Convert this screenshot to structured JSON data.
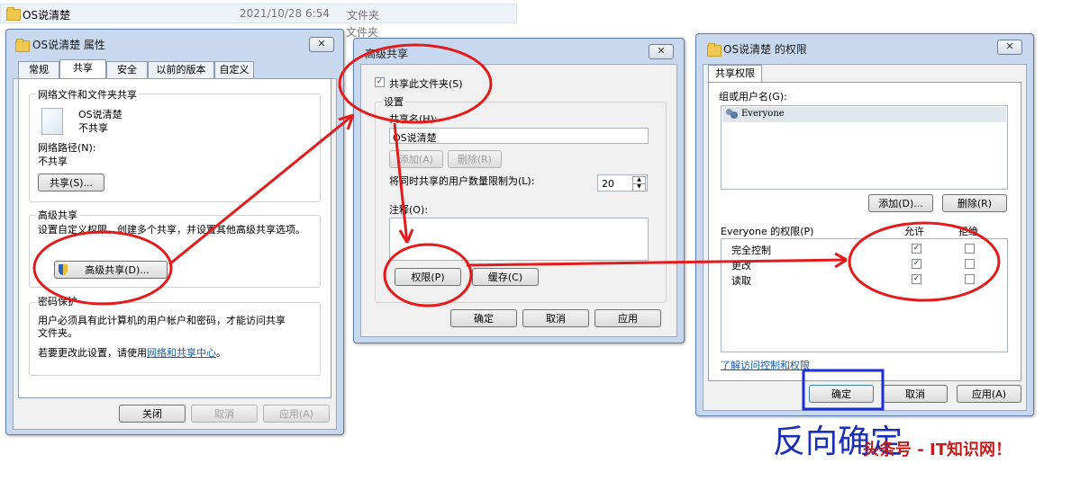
{
  "explorer": {
    "name": "OS说清楚",
    "date": "2021/10/28 6:54",
    "type": "文件夹",
    "type2": "文件夹"
  },
  "props": {
    "title": "OS说清楚 属性",
    "tabs": [
      "常规",
      "共享",
      "安全",
      "以前的版本",
      "自定义"
    ],
    "net_share_heading": "网络文件和文件夹共享",
    "folder_name": "OS说清楚",
    "folder_status": "不共享",
    "network_path_label": "网络路径(N):",
    "network_path_value": "不共享",
    "share_button": "共享(S)...",
    "adv_heading": "高级共享",
    "adv_desc": "设置自定义权限，创建多个共享，并设置其他高级共享选项。",
    "adv_button": "高级共享(D)...",
    "pw_heading": "密码保护",
    "pw_desc1": "用户必须具有此计算机的用户帐户和密码，才能访问共享",
    "pw_desc2": "文件夹。",
    "change_prefix": "若要更改此设置，请使用",
    "change_link": "网络和共享中心",
    "change_suffix": "。",
    "close": "关闭",
    "cancel": "取消",
    "apply": "应用(A)"
  },
  "adv": {
    "title": "高级共享",
    "share_check": "共享此文件夹(S)",
    "settings": "设置",
    "share_name_label": "共享名(H):",
    "share_name_value": "OS说清楚",
    "add": "添加(A)",
    "remove": "删除(R)",
    "limit_label": "将同时共享的用户数量限制为(L):",
    "limit_value": "20",
    "comment_label": "注释(O):",
    "perm_button": "权限(P)",
    "cache_button": "缓存(C)",
    "ok": "确定",
    "cancel": "取消",
    "apply": "应用"
  },
  "perm": {
    "title": "OS说清楚 的权限",
    "tab": "共享权限",
    "group_label": "组或用户名(G):",
    "user": "Everyone",
    "add": "添加(D)...",
    "remove": "删除(R)",
    "perm_for": "Everyone 的权限(P)",
    "allow": "允许",
    "deny": "拒绝",
    "rows": [
      {
        "name": "完全控制",
        "allow": "✓",
        "deny": ""
      },
      {
        "name": "更改",
        "allow": "✓",
        "deny": ""
      },
      {
        "name": "读取",
        "allow": "✓",
        "deny": ""
      }
    ],
    "link": "了解访问控制和权限",
    "ok": "确定",
    "cancel": "取消",
    "apply": "应用(A)"
  },
  "annotation": "反向确定",
  "watermark": "头条号 - IT知识网！",
  "colors": {
    "annotation_red": "#e31b1b",
    "highlight_blue": "#1a2fd8",
    "annotation_text": "#1a2fb5"
  }
}
